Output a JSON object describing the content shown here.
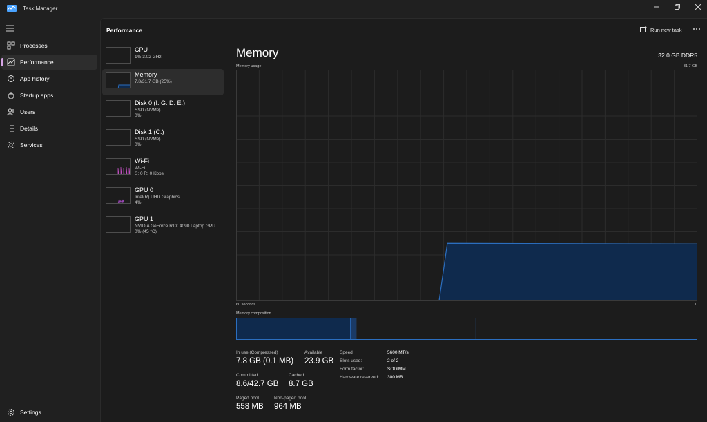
{
  "app": {
    "title": "Task Manager"
  },
  "colors": {
    "accent": "#d6a5e5",
    "memory_line": "#2b6ebf",
    "memory_fill": "#0f2a4d",
    "cpu_line": "#2b6ebf",
    "wifi_line": "#c04fc0",
    "gpu_line": "#b14fd0"
  },
  "nav": {
    "items": [
      {
        "label": "Processes",
        "icon": "processes-icon"
      },
      {
        "label": "Performance",
        "icon": "performance-icon",
        "active": true
      },
      {
        "label": "App history",
        "icon": "app-history-icon"
      },
      {
        "label": "Startup apps",
        "icon": "startup-apps-icon"
      },
      {
        "label": "Users",
        "icon": "users-icon"
      },
      {
        "label": "Details",
        "icon": "details-icon"
      },
      {
        "label": "Services",
        "icon": "services-icon"
      }
    ],
    "settings": {
      "label": "Settings",
      "icon": "settings-icon"
    }
  },
  "header": {
    "title": "Performance",
    "run_new_task": "Run new task"
  },
  "resources": [
    {
      "name": "CPU",
      "line1": "1%  3.02 GHz",
      "line2": ""
    },
    {
      "name": "Memory",
      "line1": "7.8/31.7 GB (25%)",
      "line2": "",
      "selected": true
    },
    {
      "name": "Disk 0 (I: G: D: E:)",
      "line1": "SSD (NVMe)",
      "line2": "0%"
    },
    {
      "name": "Disk 1 (C:)",
      "line1": "SSD (NVMe)",
      "line2": "0%"
    },
    {
      "name": "Wi-Fi",
      "line1": "Wi-Fi",
      "line2": "S: 0  R: 0 Kbps"
    },
    {
      "name": "GPU 0",
      "line1": "Intel(R) UHD Graphics",
      "line2": "4%"
    },
    {
      "name": "GPU 1",
      "line1": "NVIDIA GeForce RTX 4090 Laptop GPU",
      "line2": "0%  (45 °C)"
    }
  ],
  "memory": {
    "title": "Memory",
    "total": "32.0 GB DDR5",
    "usage_label": "Memory usage",
    "usage_max": "31.7 GB",
    "time_left": "60 seconds",
    "time_right": "0",
    "composition_label": "Memory composition",
    "usage_history_fraction": {
      "start_time_fraction": 0.44,
      "level": 0.25
    },
    "composition_fractions": {
      "in_use": 0.248,
      "modified": 0.012,
      "standby": 0.26,
      "free": 0.48
    },
    "stats": {
      "in_use_label": "In use (Compressed)",
      "in_use_value": "7.8 GB (0.1 MB)",
      "available_label": "Available",
      "available_value": "23.9 GB",
      "committed_label": "Committed",
      "committed_value": "8.6/42.7 GB",
      "cached_label": "Cached",
      "cached_value": "8.7 GB",
      "paged_label": "Paged pool",
      "paged_value": "558 MB",
      "nonpaged_label": "Non-paged pool",
      "nonpaged_value": "964 MB"
    },
    "hardware": {
      "speed_label": "Speed:",
      "speed_value": "5600 MT/s",
      "slots_label": "Slots used:",
      "slots_value": "2 of 2",
      "form_label": "Form factor:",
      "form_value": "SODIMM",
      "reserved_label": "Hardware reserved:",
      "reserved_value": "300 MB"
    }
  }
}
